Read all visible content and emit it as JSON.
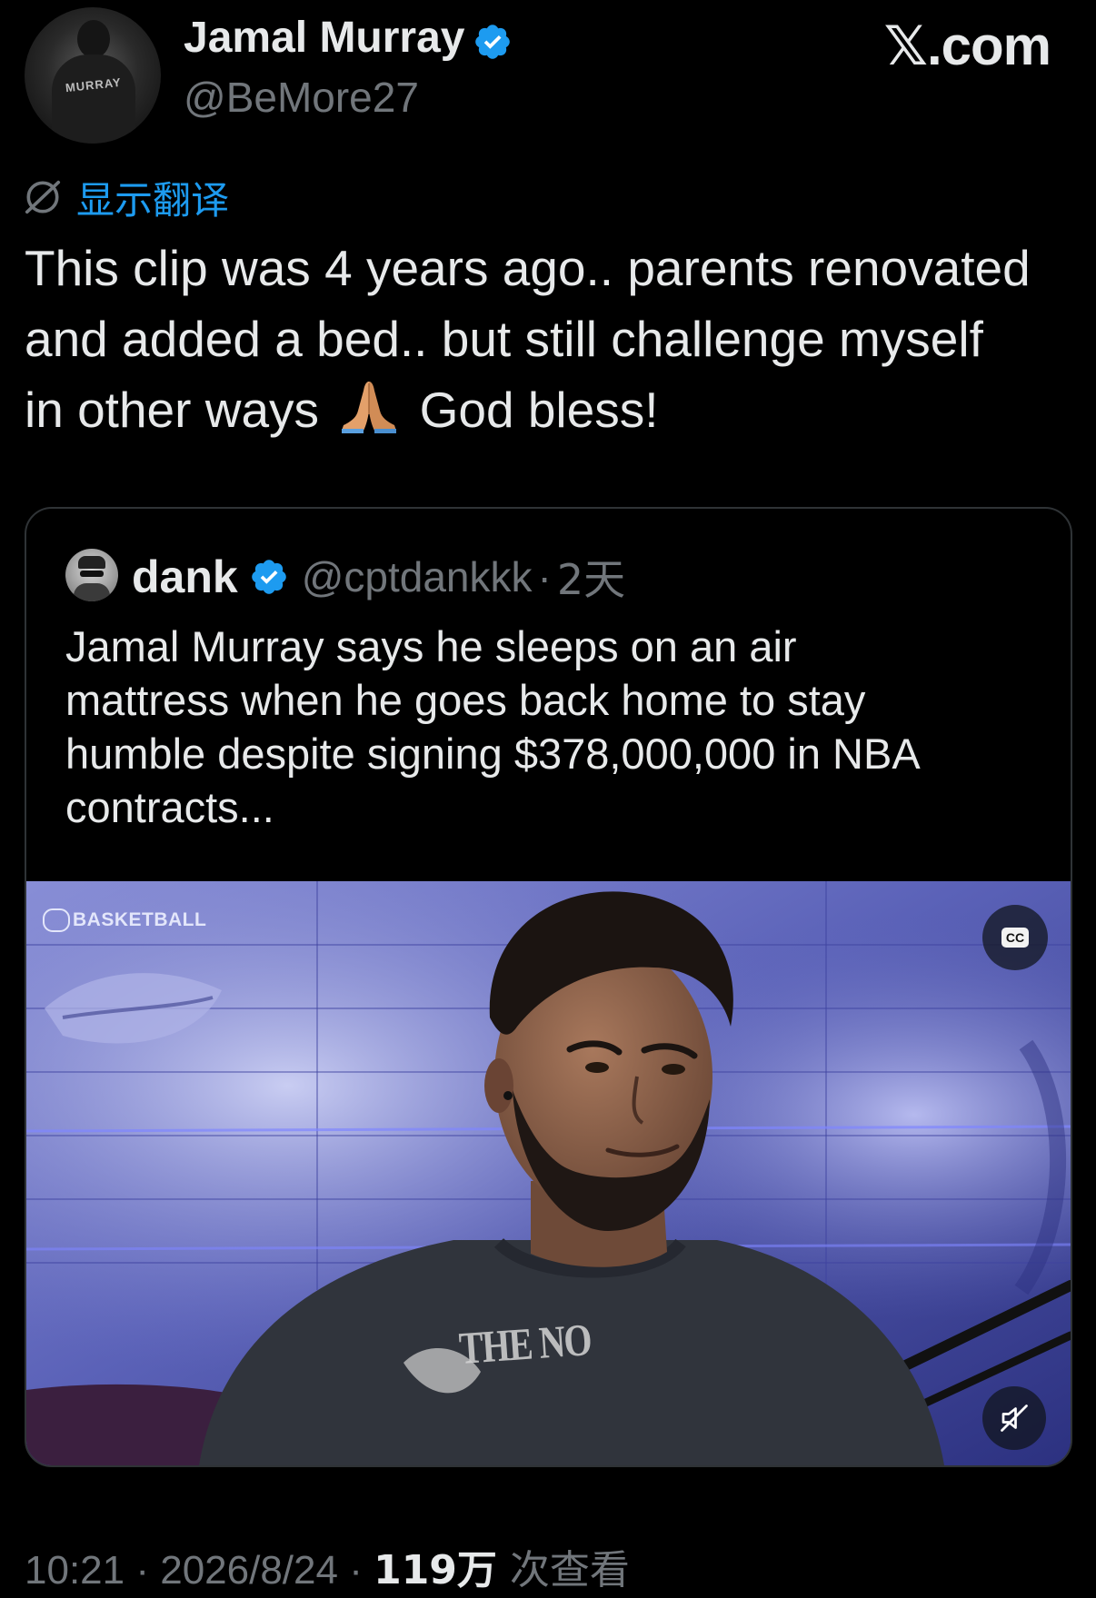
{
  "watermark": "X.com",
  "author": {
    "display_name": "Jamal Murray",
    "handle": "@BeMore27",
    "avatar_jersey_text": "MURRAY"
  },
  "translate": {
    "label": "显示翻译"
  },
  "tweet": {
    "lines": [
      "This clip was 4 years ago.. parents renovated",
      "and added a bed.. but still challenge myself",
      "in other ways"
    ],
    "line3_tail": "God bless!",
    "emoji": "folded-hands-icon"
  },
  "quoted": {
    "display_name": "dank",
    "handle": "@cptdankkk",
    "separator": "·",
    "time": "2天",
    "lines": [
      "Jamal Murray says he sleeps on an air",
      "mattress when he goes back home to stay",
      "humble despite signing $378,000,000 in NBA",
      "contracts..."
    ],
    "video": {
      "brand": "BASKETBALL",
      "shirt_text": "THE NO",
      "cc_label": "CC"
    }
  },
  "footer": {
    "time": "10:21",
    "sep1": " · ",
    "date": "2026/8/24",
    "sep2": " · ",
    "views": "119万",
    "views_label": " 次查看"
  },
  "colors": {
    "background": "#000000",
    "text": "#e7e9ea",
    "secondary": "#71767b",
    "accent": "#1d9bf0",
    "border": "#2f3336"
  }
}
